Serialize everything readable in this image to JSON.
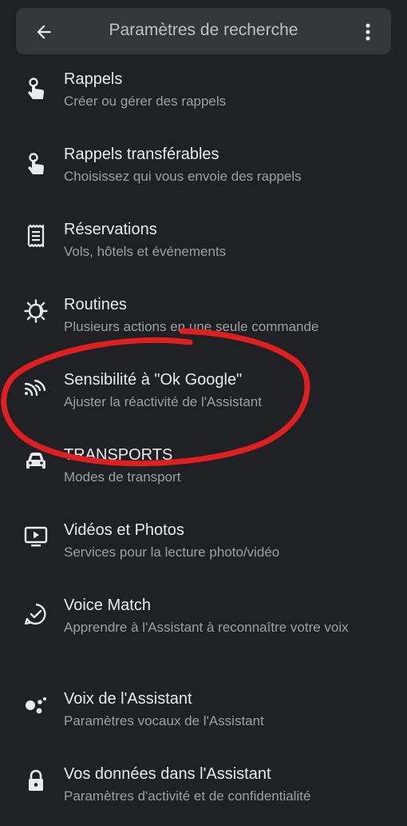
{
  "header": {
    "title": "Paramètres de recherche",
    "back_icon": "arrow-back-icon",
    "more_icon": "more-vert-icon"
  },
  "items": [
    {
      "title": "Rappels",
      "subtitle": "Créer ou gérer des rappels",
      "icon": "reminder-hand-icon"
    },
    {
      "title": "Rappels transférables",
      "subtitle": "Choisissez qui vous envoie des rappels",
      "icon": "reminder-hand-icon"
    },
    {
      "title": "Réservations",
      "subtitle": "Vols, hôtels et événements",
      "icon": "receipt-icon"
    },
    {
      "title": "Routines",
      "subtitle": "Plusieurs actions en une seule commande",
      "icon": "routine-sun-icon"
    },
    {
      "title": "Sensibilité à \"Ok Google\"",
      "subtitle": "Ajuster la réactivité de l'Assistant",
      "icon": "sensitivity-waves-icon"
    },
    {
      "title": "TRANSPORTS",
      "subtitle": "Modes de transport",
      "icon": "car-icon"
    },
    {
      "title": "Vidéos et Photos",
      "subtitle": "Services pour la lecture photo/vidéo",
      "icon": "video-tv-icon"
    },
    {
      "title": "Voice Match",
      "subtitle": "Apprendre à l'Assistant à reconnaître votre voix",
      "icon": "voice-match-icon"
    },
    {
      "title": "Voix de l'Assistant",
      "subtitle": "Paramètres vocaux de l'Assistant",
      "icon": "assistant-dots-icon"
    },
    {
      "title": "Vos données dans l'Assistant",
      "subtitle": "Paramètres d'activité et de confidentialité",
      "icon": "lock-icon"
    }
  ],
  "colors": {
    "background": "#202124",
    "topbar": "#35363a",
    "primary_text": "#e8eaed",
    "secondary_text": "#9aa0a6",
    "annotation": "#e02020"
  }
}
